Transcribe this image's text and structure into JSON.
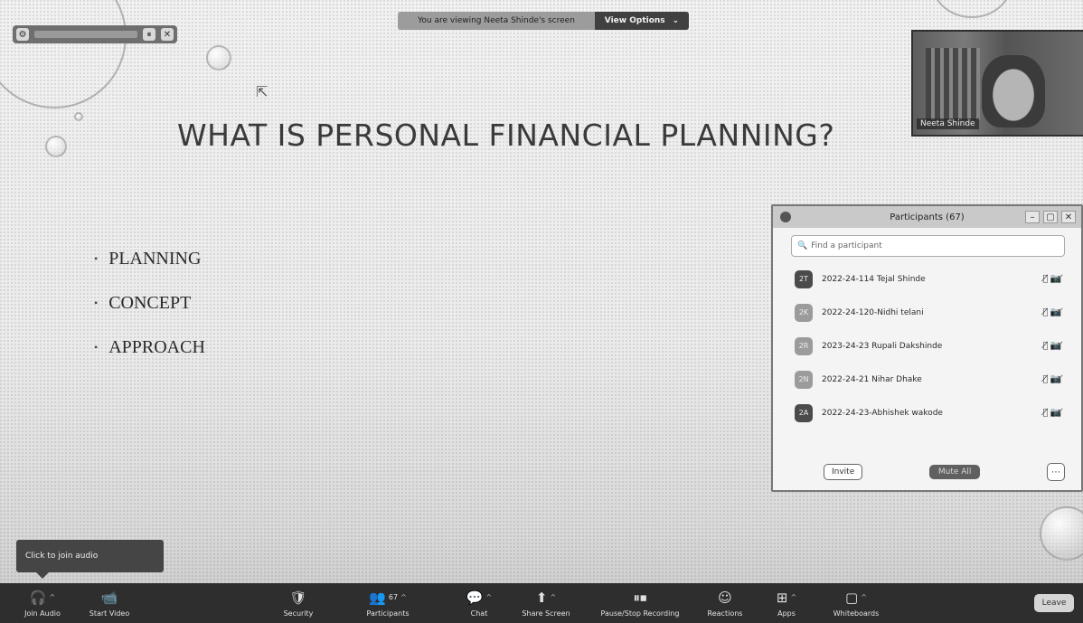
{
  "share_bar": {
    "message": "You are viewing Neeta Shinde's screen",
    "view_options": "View Options",
    "caret": "⌄"
  },
  "slide": {
    "title": "WHAT IS PERSONAL FINANCIAL PLANNING?",
    "bullets": [
      "PLANNING",
      "CONCEPT",
      "APPROACH"
    ]
  },
  "video": {
    "name": "Neeta Shinde"
  },
  "participants_panel": {
    "title": "Participants (67)",
    "search_placeholder": "Find a participant",
    "participants": [
      {
        "initials": "2T",
        "name": "2022-24-114 Tejal Shinde"
      },
      {
        "initials": "2K",
        "name": "2022-24-120-Nidhi telani"
      },
      {
        "initials": "2R",
        "name": "2023-24-23 Rupali Dakshinde"
      },
      {
        "initials": "2N",
        "name": "2022-24-21 Nihar Dhake"
      },
      {
        "initials": "2A",
        "name": "2022-24-23-Abhishek wakode"
      }
    ],
    "invite": "Invite",
    "mute_all": "Mute All",
    "more": "⋯"
  },
  "tooltip": "Click to join audio",
  "toolbar": {
    "items": [
      {
        "label": "Join Audio",
        "icon": "🎧"
      },
      {
        "label": "Start Video",
        "icon": "📹"
      },
      {
        "label": "Security",
        "icon": "🛡"
      },
      {
        "label": "Participants",
        "icon": "👥",
        "count": "67"
      },
      {
        "label": "Chat",
        "icon": "💬"
      },
      {
        "label": "Share Screen",
        "icon": "⬆"
      },
      {
        "label": "Pause/Stop Recording",
        "icon": "⏸⏹"
      },
      {
        "label": "Reactions",
        "icon": "☺"
      },
      {
        "label": "Apps",
        "icon": "⊞"
      },
      {
        "label": "Whiteboards",
        "icon": "▢"
      }
    ],
    "leave": "Leave"
  }
}
